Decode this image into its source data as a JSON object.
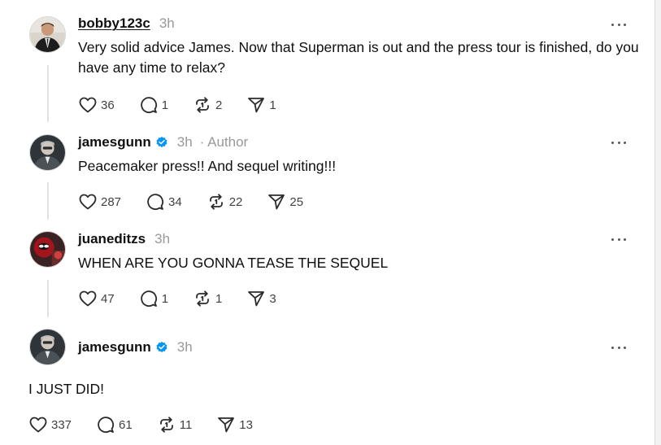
{
  "colors": {
    "verified": "#0095f6",
    "meta_text": "#999999",
    "thread_line": "#e2e2e2"
  },
  "icons": {
    "like": "heart-icon",
    "reply": "comment-icon",
    "repost": "repost-icon",
    "share": "send-icon",
    "more": "more-dots-icon",
    "verified": "verified-badge-icon"
  },
  "posts": [
    {
      "username": "bobby123c",
      "time": "3h",
      "text": "Very solid advice James. Now that Superman is out and the press tour is finished, do you have any time to relax?",
      "likes": "36",
      "replies": "1",
      "reposts": "2",
      "shares": "1"
    },
    {
      "username": "jamesgunn",
      "verified": true,
      "time": "3h",
      "author_label": "· Author",
      "text": "Peacemaker press!! And sequel writing!!!",
      "likes": "287",
      "replies": "34",
      "reposts": "22",
      "shares": "25"
    },
    {
      "username": "juaneditzs",
      "time": "3h",
      "text": "WHEN ARE YOU GONNA TEASE THE SEQUEL",
      "likes": "47",
      "replies": "1",
      "reposts": "1",
      "shares": "3"
    },
    {
      "username": "jamesgunn",
      "verified": true,
      "time": "3h",
      "text": "I JUST DID!",
      "likes": "337",
      "replies": "61",
      "reposts": "11",
      "shares": "13"
    }
  ]
}
